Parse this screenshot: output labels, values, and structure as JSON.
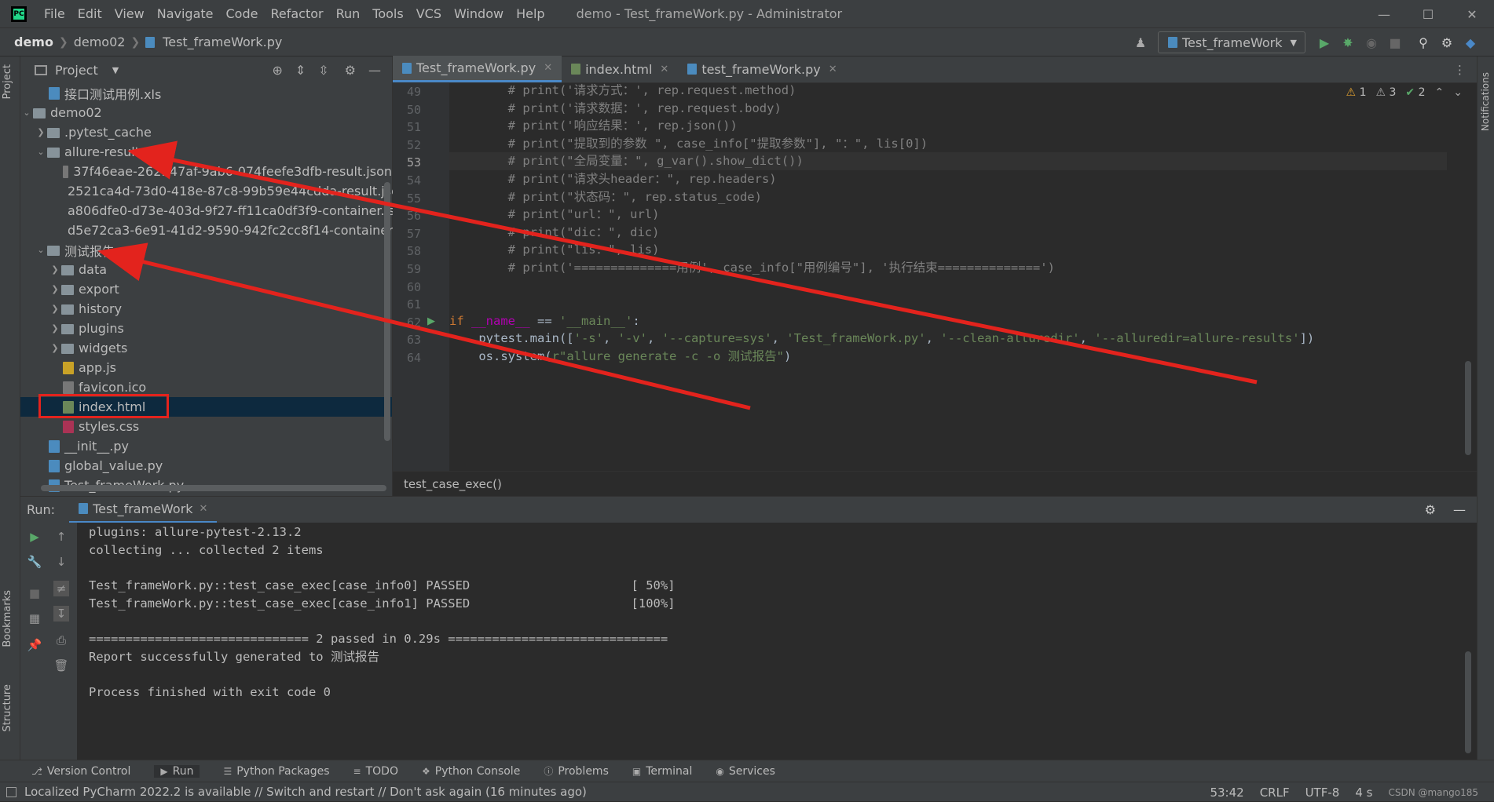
{
  "menubar": {
    "items": [
      "File",
      "Edit",
      "View",
      "Navigate",
      "Code",
      "Refactor",
      "Run",
      "Tools",
      "VCS",
      "Window",
      "Help"
    ],
    "window_title": "demo - Test_frameWork.py - Administrator"
  },
  "navbar": {
    "crumbs": [
      "demo",
      "demo02",
      "Test_frameWork.py"
    ],
    "run_config": "Test_frameWork"
  },
  "project": {
    "header": "Project",
    "tree": [
      {
        "label": "接口测试用例.xls",
        "depth": 1,
        "kind": "xls"
      },
      {
        "label": "demo02",
        "depth": 0,
        "kind": "folder",
        "arrow": "open"
      },
      {
        "label": ".pytest_cache",
        "depth": 1,
        "kind": "folder",
        "arrow": "closed"
      },
      {
        "label": "allure-results",
        "depth": 1,
        "kind": "folder",
        "arrow": "open"
      },
      {
        "label": "37f46eae-262f-47af-9ab6-074feefe3dfb-result.json",
        "depth": 2,
        "kind": "json"
      },
      {
        "label": "2521ca4d-73d0-418e-87c8-99b59e44cdda-result.json",
        "depth": 2,
        "kind": "json"
      },
      {
        "label": "a806dfe0-d73e-403d-9f27-ff11ca0df3f9-container.json",
        "depth": 2,
        "kind": "json"
      },
      {
        "label": "d5e72ca3-6e91-41d2-9590-942fc2cc8f14-container.json",
        "depth": 2,
        "kind": "json"
      },
      {
        "label": "测试报告",
        "depth": 1,
        "kind": "folder",
        "arrow": "open"
      },
      {
        "label": "data",
        "depth": 2,
        "kind": "folder",
        "arrow": "closed"
      },
      {
        "label": "export",
        "depth": 2,
        "kind": "folder",
        "arrow": "closed"
      },
      {
        "label": "history",
        "depth": 2,
        "kind": "folder",
        "arrow": "closed"
      },
      {
        "label": "plugins",
        "depth": 2,
        "kind": "folder",
        "arrow": "closed"
      },
      {
        "label": "widgets",
        "depth": 2,
        "kind": "folder",
        "arrow": "closed"
      },
      {
        "label": "app.js",
        "depth": 2,
        "kind": "js"
      },
      {
        "label": "favicon.ico",
        "depth": 2,
        "kind": "ico"
      },
      {
        "label": "index.html",
        "depth": 2,
        "kind": "html",
        "selected": true
      },
      {
        "label": "styles.css",
        "depth": 2,
        "kind": "css"
      },
      {
        "label": "__init__.py",
        "depth": 1,
        "kind": "py"
      },
      {
        "label": "global_value.py",
        "depth": 1,
        "kind": "py"
      },
      {
        "label": "Test_frameWork.py",
        "depth": 1,
        "kind": "py"
      }
    ]
  },
  "editor": {
    "tabs": [
      "Test_frameWork.py",
      "index.html",
      "test_frameWork.py"
    ],
    "inspections": {
      "warn1": "1",
      "warn2": "3",
      "ok": "2"
    },
    "line_numbers": [
      "49",
      "50",
      "51",
      "52",
      "53",
      "54",
      "55",
      "56",
      "57",
      "58",
      "59",
      "60",
      "61",
      "62",
      "63",
      "64"
    ],
    "lines": [
      "        # print('请求方式：', rep.request.method)",
      "        # print('请求数据：', rep.request.body)",
      "        # print('响应结果：', rep.json())",
      "        # print(\"提取到的参数 \", case_info[\"提取参数\"], \"：\", lis[0])",
      "        # print(\"全局变量：\", g_var().show_dict())",
      "        # print(\"请求头header：\", rep.headers)",
      "        # print(\"状态码：\", rep.status_code)",
      "        # print(\"url：\", url)",
      "        # print(\"dic：\", dic)",
      "        # print(\"lis：\", lis)",
      "        # print('==============用例', case_info[\"用例编号\"], '执行结束==============')",
      "",
      "",
      "if __name__ == '__main__':",
      "    pytest.main(['-s', '-v', '--capture=sys', 'Test_frameWork.py', '--clean-alluredir', '--alluredir=allure-results'])",
      "    os.system(r\"allure generate -c -o 测试报告\")"
    ],
    "breadcrumb": "test_case_exec()"
  },
  "run": {
    "label": "Run:",
    "tab": "Test_frameWork",
    "console": [
      "plugins: allure-pytest-2.13.2",
      "collecting ... collected 2 items",
      "",
      "Test_frameWork.py::test_case_exec[case_info0] PASSED                      [ 50%]",
      "Test_frameWork.py::test_case_exec[case_info1] PASSED                      [100%]",
      "",
      "============================== 2 passed in 0.29s ==============================",
      "Report successfully generated to 测试报告",
      "",
      "Process finished with exit code 0"
    ]
  },
  "tool_windows": [
    "Version Control",
    "Run",
    "Python Packages",
    "TODO",
    "Python Console",
    "Problems",
    "Terminal",
    "Services"
  ],
  "side_tabs": {
    "left_top": "Project",
    "left_bottom1": "Bookmarks",
    "left_bottom2": "Structure",
    "right": "Notifications"
  },
  "statusbar": {
    "message": "Localized PyCharm 2022.2 is available // Switch and restart // Don't ask again (16 minutes ago)",
    "position": "53:42",
    "line_sep": "CRLF",
    "encoding": "UTF-8",
    "indent": "4 s",
    "watermark": "CSDN @mango185"
  },
  "colors": {
    "arrow": "#e3231d",
    "selection": "#0d293e",
    "accent": "#4a88c7"
  }
}
